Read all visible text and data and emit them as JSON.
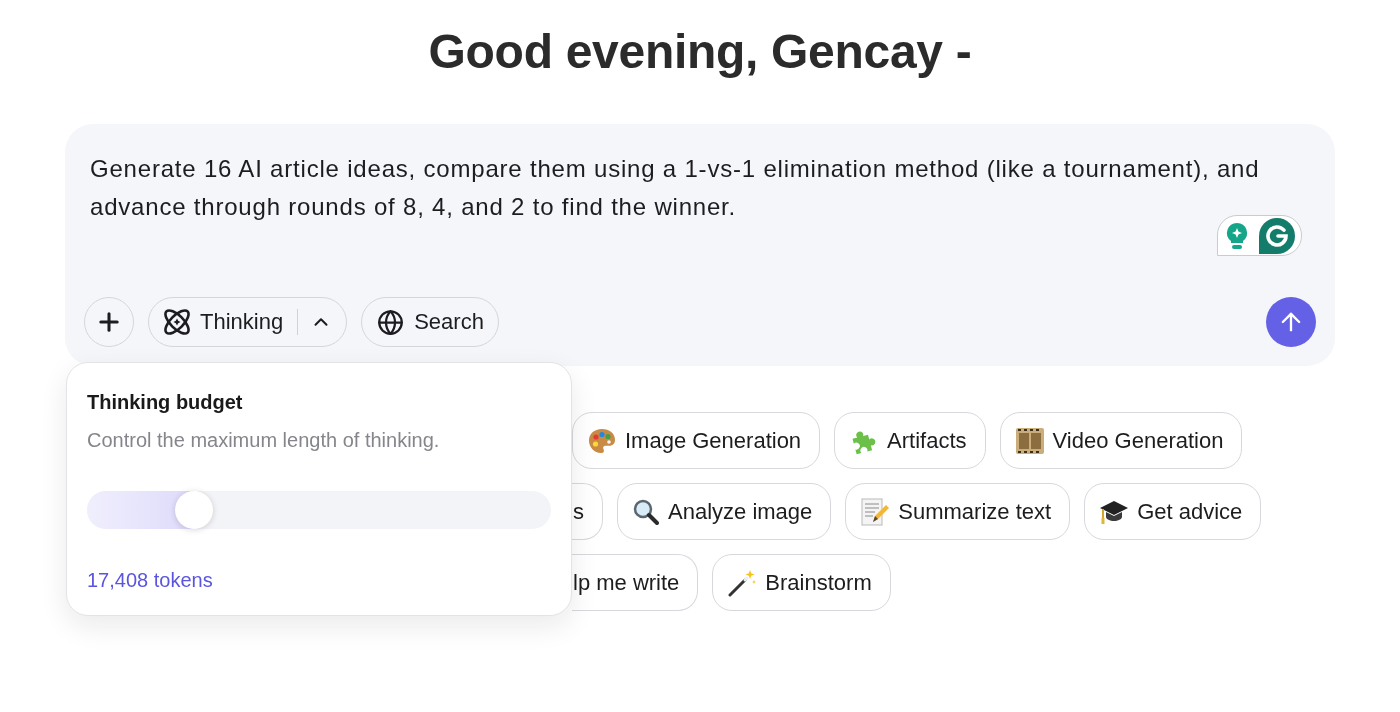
{
  "greeting": "Good evening, Gencay -",
  "composer": {
    "value": "Generate 16 AI article ideas, compare them using a 1-vs-1 elimination method (like a tournament), and advance through rounds of 8, 4, and 2 to find the winner.",
    "thinking_button": {
      "label": "Thinking",
      "expanded": true
    },
    "search_button": {
      "label": "Search"
    }
  },
  "thinking_budget": {
    "title": "Thinking budget",
    "description": "Control the maximum length of thinking.",
    "level": 0.23,
    "reading": "17,408 tokens"
  },
  "suggestion_rows": [
    {
      "chips": [
        {
          "kind": "full",
          "label": "Image Generation"
        },
        {
          "kind": "full",
          "label": "Artifacts"
        },
        {
          "kind": "full",
          "label": "Video Generation"
        }
      ]
    },
    {
      "chips": [
        {
          "kind": "clipped",
          "label": "s"
        },
        {
          "kind": "full",
          "label": "Analyze image"
        },
        {
          "kind": "full",
          "label": "Summarize text"
        },
        {
          "kind": "full",
          "label": "Get advice"
        }
      ]
    },
    {
      "chips": [
        {
          "kind": "clipped",
          "label": "lp me write"
        },
        {
          "kind": "full",
          "label": "Brainstorm"
        }
      ]
    }
  ]
}
